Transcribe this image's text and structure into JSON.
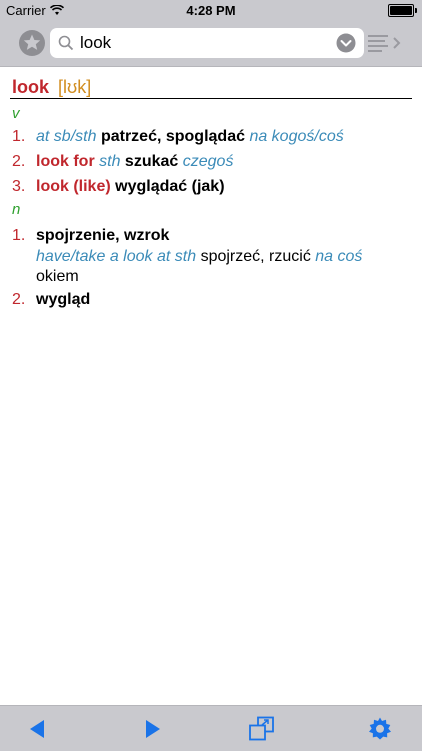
{
  "status": {
    "carrier": "Carrier",
    "time": "4:28 PM"
  },
  "search": {
    "query": "look",
    "placeholder": ""
  },
  "entry": {
    "word": "look",
    "pronunciation": "[lʊk]",
    "verb_pos": "v",
    "verb_senses": [
      {
        "num": "1.",
        "gram": "at sb/sth",
        "translation": "patrzeć, spoglądać",
        "note": "na kogoś/coś"
      },
      {
        "num": "2.",
        "phrase": "look for",
        "gram": "sth",
        "translation": "szukać",
        "note": "czegoś"
      },
      {
        "num": "3.",
        "phrase": "look (like)",
        "translation": "wyglądać (jak)"
      }
    ],
    "noun_pos": "n",
    "noun_senses": [
      {
        "num": "1.",
        "translation": "spojrzenie, wzrok",
        "example_phrase": "have/take a look at sth",
        "example_translation": "spojrzeć, rzucić",
        "example_note": "na coś",
        "example_tail": "okiem"
      },
      {
        "num": "2.",
        "translation": "wygląd"
      }
    ]
  },
  "colors": {
    "bar": "#c9c9ce",
    "accent": "#1a73e8",
    "headword": "#c0272d",
    "pos": "#2ea02e",
    "gram": "#3b8bb8"
  },
  "icons": [
    "star-icon",
    "search-icon",
    "chevron-down-icon",
    "list-icon",
    "back-icon",
    "forward-icon",
    "window-icon",
    "gear-icon",
    "wifi-icon"
  ]
}
